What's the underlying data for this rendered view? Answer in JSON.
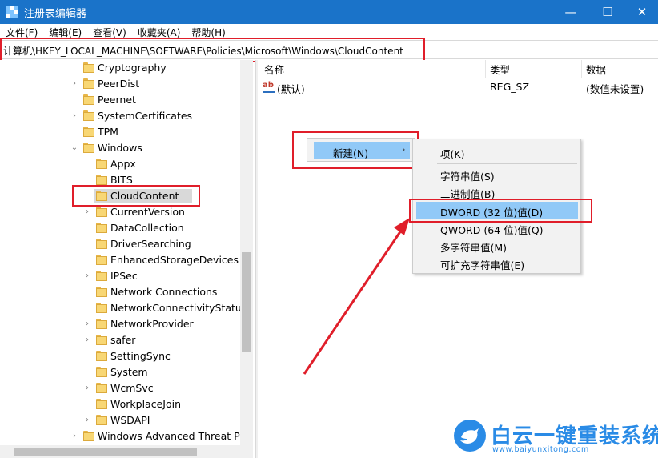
{
  "window": {
    "title": "注册表编辑器",
    "minimize_glyph": "—",
    "maximize_glyph": "☐",
    "close_glyph": "✕"
  },
  "menu": [
    "文件(F)",
    "编辑(E)",
    "查看(V)",
    "收藏夹(A)",
    "帮助(H)"
  ],
  "address": "计算机\\HKEY_LOCAL_MACHINE\\SOFTWARE\\Policies\\Microsoft\\Windows\\CloudContent",
  "tree": {
    "items": [
      {
        "label": "Cryptography",
        "expander": ""
      },
      {
        "label": "PeerDist",
        "expander": "›"
      },
      {
        "label": "Peernet",
        "expander": ""
      },
      {
        "label": "SystemCertificates",
        "expander": "›"
      },
      {
        "label": "TPM",
        "expander": ""
      },
      {
        "label": "Windows",
        "expander": "⌄"
      },
      {
        "label": "Appx",
        "expander": ""
      },
      {
        "label": "BITS",
        "expander": ""
      },
      {
        "label": "CloudContent",
        "expander": "",
        "selected": true
      },
      {
        "label": "CurrentVersion",
        "expander": "›"
      },
      {
        "label": "DataCollection",
        "expander": ""
      },
      {
        "label": "DriverSearching",
        "expander": ""
      },
      {
        "label": "EnhancedStorageDevices",
        "expander": ""
      },
      {
        "label": "IPSec",
        "expander": "›"
      },
      {
        "label": "Network Connections",
        "expander": ""
      },
      {
        "label": "NetworkConnectivityStatusIn",
        "expander": ""
      },
      {
        "label": "NetworkProvider",
        "expander": "›"
      },
      {
        "label": "safer",
        "expander": "›"
      },
      {
        "label": "SettingSync",
        "expander": ""
      },
      {
        "label": "System",
        "expander": ""
      },
      {
        "label": "WcmSvc",
        "expander": "›"
      },
      {
        "label": "WorkplaceJoin",
        "expander": ""
      },
      {
        "label": "WSDAPI",
        "expander": "›"
      },
      {
        "label": "Windows Advanced Threat Pro",
        "expander": "›"
      }
    ]
  },
  "values": {
    "headers": {
      "name": "名称",
      "type": "类型",
      "data": "数据"
    },
    "rows": [
      {
        "icon": "ab",
        "name": "(默认)",
        "type": "REG_SZ",
        "data": "(数值未设置)"
      }
    ]
  },
  "context_menu": {
    "new_label": "新建(N)",
    "submenu_arrow": "›",
    "submenu": [
      "项(K)",
      "字符串值(S)",
      "二进制值(B)",
      "DWORD (32 位)值(D)",
      "QWORD (64 位)值(Q)",
      "多字符串值(M)",
      "可扩充字符串值(E)"
    ]
  },
  "watermark": {
    "name": "白云一键重装系统",
    "url": "www.baiyunxitong.com"
  },
  "colors": {
    "titlebar": "#1a73c9",
    "selection": "#91c9f7",
    "annotation": "#e01e2a",
    "brand": "#2a8be6"
  }
}
